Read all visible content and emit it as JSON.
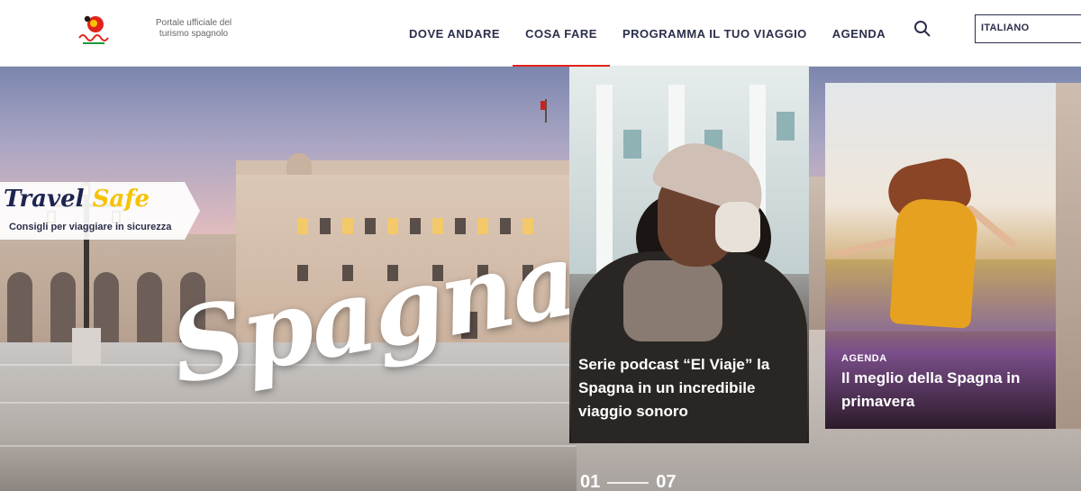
{
  "header": {
    "logo_name": "espana-logo-icon",
    "tagline": "Portale ufficiale del turismo spagnolo",
    "nav": [
      {
        "label": "DOVE ANDARE",
        "active": false
      },
      {
        "label": "COSA FARE",
        "active": true
      },
      {
        "label": "PROGRAMMA IL TUO VIAGGIO",
        "active": false
      },
      {
        "label": "AGENDA",
        "active": false
      }
    ],
    "search_icon": "search-icon",
    "language": "ITALIANO"
  },
  "hero": {
    "badge_title_1": "Travel",
    "badge_title_2": "Safe",
    "badge_subtitle": "Consigli per viaggiare in sicurezza",
    "headline": "Spagna"
  },
  "cards": [
    {
      "text": "Serie podcast “El Viaje” la Spagna in un incredibile viaggio sonoro"
    },
    {
      "tag": "AGENDA",
      "text": "Il meglio della Spagna in primavera"
    }
  ],
  "pager": {
    "current": "01",
    "total": "07"
  },
  "colors": {
    "accent": "#e2231a",
    "nav_text": "#2b2f4a",
    "badge_yellow": "#f5c300"
  }
}
